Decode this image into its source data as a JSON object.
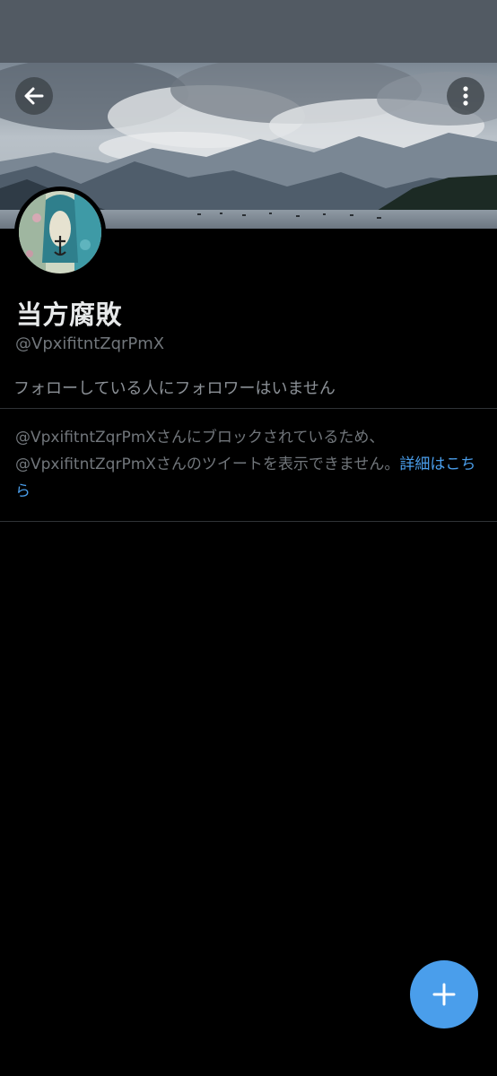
{
  "profile": {
    "display_name": "当方腐敗",
    "handle": "@VpxifitntZqrPmX",
    "follow_note": "フォローしている人にフォロワーはいません"
  },
  "block_notice": {
    "message_line1": "@VpxifitntZqrPmXさんにブロックされているため、",
    "message_line2": "@VpxifitntZqrPmXさんのツイートを表示できません。",
    "learn_more": "詳細はこちら"
  },
  "icons": {
    "back": "arrow-left-icon",
    "more": "more-vertical-icon",
    "compose": "plus-icon"
  },
  "colors": {
    "accent": "#4a9eeb",
    "status_bar": "#525a63",
    "background": "#000000",
    "secondary_text": "#71767b"
  }
}
